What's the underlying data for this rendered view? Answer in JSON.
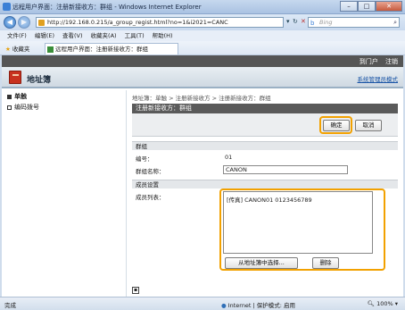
{
  "window": {
    "title": "远程用户界面：注册新接收方：群组 - Windows Internet Explorer",
    "minimize": "–",
    "maximize": "□",
    "close": "✕"
  },
  "address_bar": {
    "back": "◀",
    "forward": "▶",
    "url": "http://192.168.0.215/a_group_regist.html?no=1&i2021=CANC",
    "refresh": "↻",
    "stop": "✕",
    "search_placeholder": "Bing",
    "search_engine_icon": "b"
  },
  "menu": [
    "文件(F)",
    "编辑(E)",
    "查看(V)",
    "收藏夹(A)",
    "工具(T)",
    "帮助(H)"
  ],
  "favorites": {
    "label": "收藏夹",
    "tab_title": "远程用户界面：注册新接收方：群组"
  },
  "header": {
    "portal_link": "到门户",
    "logout": "注销",
    "title": "地址簿",
    "admin_mode": "系统管理员模式"
  },
  "sidebar": {
    "items": [
      {
        "label": "单触",
        "active": true
      },
      {
        "label": "编码拨号",
        "active": false
      }
    ]
  },
  "content": {
    "breadcrumb": "地址簿：单触 > 注册新接收方 > 注册新接收方：群组",
    "panel_title": "注册新接收方：群组",
    "ok_label": "确定",
    "cancel_label": "取消",
    "group_section": "群组",
    "number_label": "编号：",
    "number_value": "01",
    "group_name_label": "群组名称：",
    "group_name_value": "CANON",
    "member_section": "成员设置",
    "member_list_label": "成员列表：",
    "member_entry": "[传真] CANON01 0123456789",
    "select_from_addressbook": "从地址簿中选择...",
    "delete_label": "删除"
  },
  "status_bar": {
    "left": "完成",
    "zone": "Internet | 保护模式: 启用",
    "zoom": "100%"
  },
  "colors": {
    "highlight": "#f2a100",
    "panel_header": "#5a5a5a"
  }
}
